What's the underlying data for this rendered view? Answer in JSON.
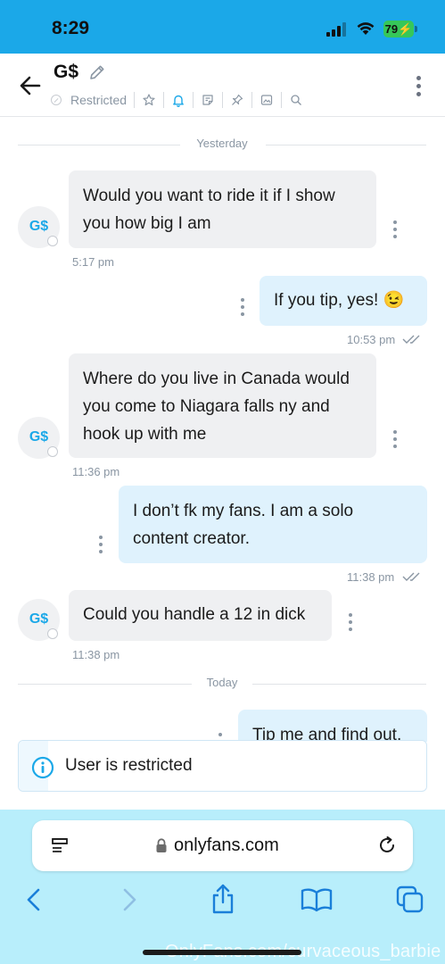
{
  "status_bar": {
    "time": "8:29",
    "battery": "79"
  },
  "header": {
    "name": "G$",
    "restricted_label": "Restricted"
  },
  "messages": [
    {
      "dir": "in",
      "text": "Would you want to ride it if I show you how big I am",
      "time": "5:17 pm"
    },
    {
      "dir": "out",
      "text": "If you tip, yes! 😉",
      "time": "10:53 pm"
    },
    {
      "dir": "in",
      "text": "Where do you live in Canada would you come to Niagara falls ny and hook up with me",
      "time": "11:36 pm"
    },
    {
      "dir": "out",
      "text": "I don’t fk my fans. I am a solo content creator.",
      "time": "11:38 pm"
    },
    {
      "dir": "in",
      "text": "Could you handle a 12 in dick",
      "time": "11:38 pm"
    },
    {
      "dir": "out",
      "text": "Tip me and find out."
    }
  ],
  "dividers": {
    "yesterday": "Yesterday",
    "today": "Today"
  },
  "avatar_initials": "G$",
  "banner": {
    "text": "User is restricted"
  },
  "browser": {
    "domain": "onlyfans.com"
  },
  "watermark": "OnlyFans.com/curvaceous_barbie",
  "colors": {
    "accent": "#1ba8e8",
    "incoming_bubble": "#eff0f2",
    "outgoing_bubble": "#dff2fd",
    "safari_toolbar": "#b8eefb",
    "battery": "#36c759"
  }
}
